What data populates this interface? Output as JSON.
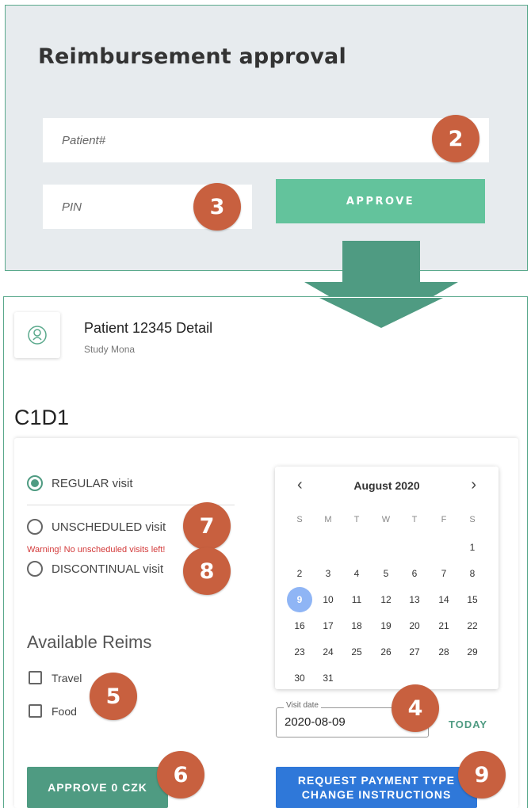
{
  "login": {
    "title": "Reimbursement approval",
    "patient_placeholder": "Patient#",
    "pin_placeholder": "PIN",
    "approve_label": "APPROVE"
  },
  "patient": {
    "title": "Patient 12345 Detail",
    "study": "Study Mona",
    "visit_code": "C1D1",
    "avatar_icon": "user-outline-icon"
  },
  "visit_types": [
    {
      "label": "REGULAR visit",
      "checked": true
    },
    {
      "label": "UNSCHEDULED visit",
      "checked": false
    },
    {
      "label": "DISCONTINUAL visit",
      "checked": false
    }
  ],
  "warning": "Warning! No unscheduled visits left!",
  "reims": {
    "title": "Available Reims",
    "items": [
      "Travel",
      "Food"
    ]
  },
  "calendar": {
    "prev": "‹",
    "next": "›",
    "month": "August 2020",
    "weekdays": [
      "S",
      "M",
      "T",
      "W",
      "T",
      "F",
      "S"
    ],
    "days": [
      "1",
      "2",
      "3",
      "4",
      "5",
      "6",
      "7",
      "8",
      "9",
      "10",
      "11",
      "12",
      "13",
      "14",
      "15",
      "16",
      "17",
      "18",
      "19",
      "20",
      "21",
      "22",
      "23",
      "24",
      "25",
      "26",
      "27",
      "28",
      "29",
      "30",
      "31"
    ],
    "selected": "9"
  },
  "visit_date": {
    "label": "Visit date",
    "value": "2020-08-09",
    "today": "TODAY"
  },
  "actions": {
    "approve": "APPROVE 0 CZK",
    "request_line1": "REQUEST PAYMENT TYPE",
    "request_line2": "CHANGE INSTRUCTIONS"
  },
  "badges": [
    "2",
    "3",
    "7",
    "8",
    "4",
    "5",
    "6",
    "9"
  ],
  "colors": {
    "accent_green": "#63c39c",
    "dark_green": "#4f9b82",
    "badge": "#c8603f",
    "blue": "#2f78d9",
    "warning": "#d33a3a",
    "selected_day": "#8fb5f5"
  }
}
